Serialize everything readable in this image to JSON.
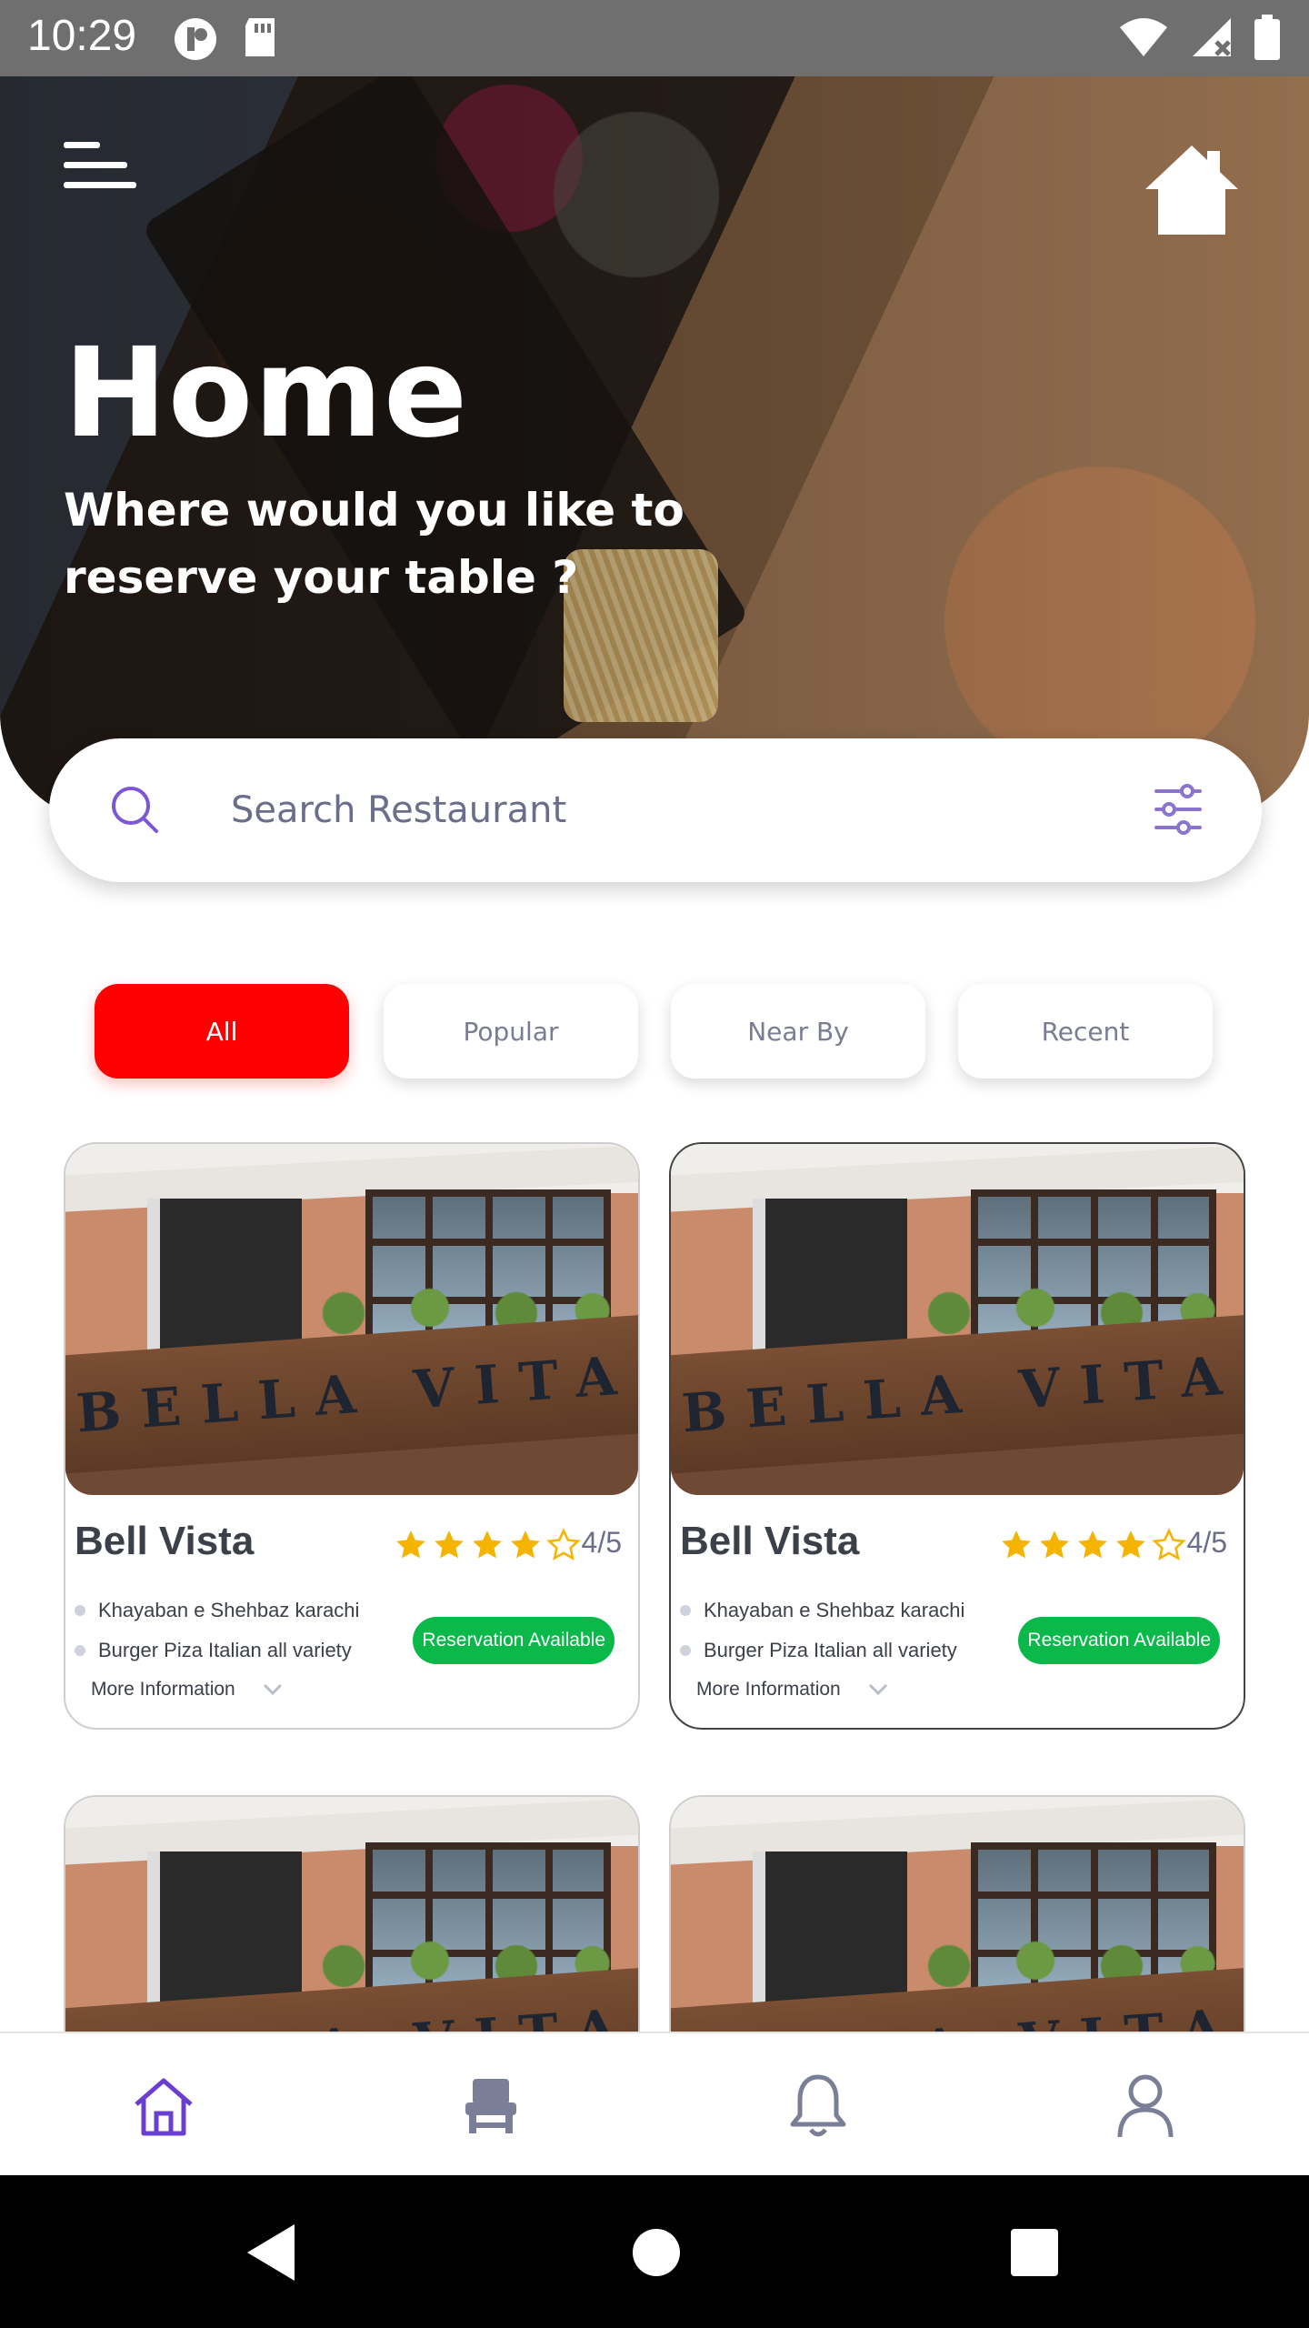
{
  "status_bar": {
    "time": "10:29",
    "left_icons": [
      "app-badge-icon",
      "sd-card-icon"
    ],
    "right_icons": [
      "wifi-icon",
      "signal-no-data-icon",
      "battery-icon"
    ]
  },
  "hero": {
    "title": "Home",
    "subtitle": "Where would you like to reserve your table ?",
    "menu_icon": "hamburger-menu-icon",
    "home_icon": "home-icon"
  },
  "search": {
    "placeholder": "Search Restaurant",
    "value": ""
  },
  "tabs": [
    {
      "label": "All",
      "active": true
    },
    {
      "label": "Popular",
      "active": false
    },
    {
      "label": "Near By",
      "active": false
    },
    {
      "label": "Recent",
      "active": false
    }
  ],
  "cards": [
    {
      "name": "Bell Vista",
      "rating": "4/5",
      "stars": 4,
      "address": "Khayaban e Shehbaz karachi",
      "cuisine": "Burger Piza Italian all variety",
      "more": "More Information",
      "badge": "Reservation Available",
      "sign_text": "BELLA VITA"
    },
    {
      "name": "Bell Vista",
      "rating": "4/5",
      "stars": 4,
      "address": "Khayaban e Shehbaz karachi",
      "cuisine": "Burger Piza Italian all variety",
      "more": "More Information",
      "badge": "Reservation Available",
      "sign_text": "BELLA VITA"
    },
    {
      "sign_text": "BELLA VITA"
    },
    {
      "sign_text": "BELLA VITA"
    }
  ],
  "bottom_nav": [
    "home-icon",
    "chair-icon",
    "bell-icon",
    "user-icon"
  ],
  "colors": {
    "accent_red": "#ff0000",
    "badge_green": "#0ab94a",
    "nav_active": "#6a3fd0",
    "nav_inactive": "#7a7e96",
    "star_gold": "#f5b400"
  }
}
